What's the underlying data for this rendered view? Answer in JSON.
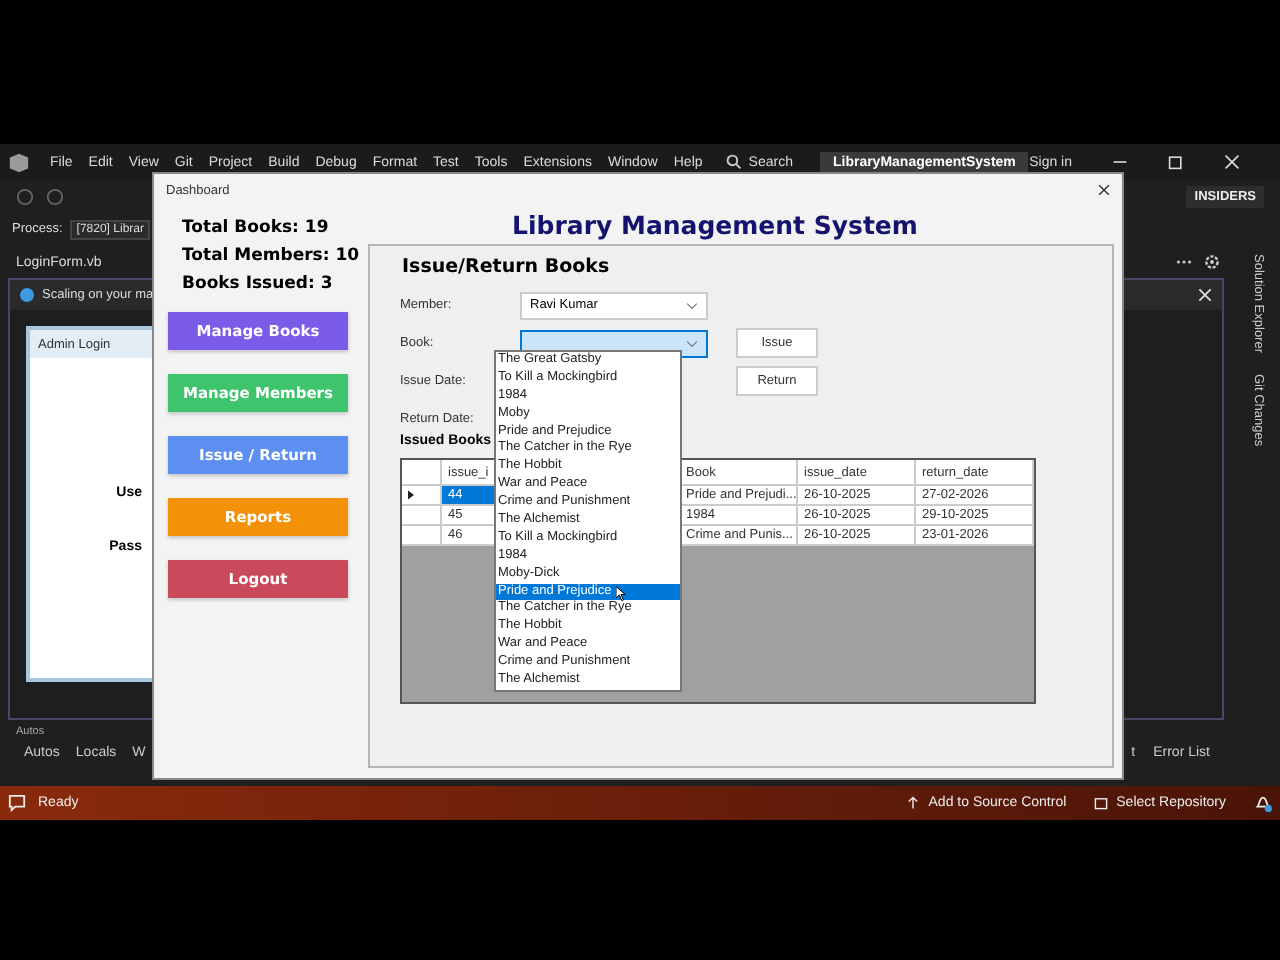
{
  "ide": {
    "menu": [
      "File",
      "Edit",
      "View",
      "Git",
      "Project",
      "Build",
      "Debug",
      "Format",
      "Test",
      "Tools",
      "Extensions",
      "Window",
      "Help"
    ],
    "search": "Search",
    "solution": "LibraryManagementSystem",
    "sign_in": "Sign in",
    "badge": "INSIDERS",
    "process_label": "Process:",
    "process_value": "[7820] Librar",
    "file_tab": "LoginForm.vb",
    "info_bar": "Scaling on your ma",
    "side_tabs": [
      "Solution Explorer",
      "Git Changes"
    ],
    "login_form": {
      "title": "Admin Login",
      "labels": [
        "Use",
        "Pass"
      ]
    },
    "bottom_panel_title": "Autos",
    "bottom_tabs": [
      "Autos",
      "Locals",
      "W"
    ],
    "bottom_tabs_right": [
      "t",
      "Error List"
    ],
    "status": {
      "text": "Ready",
      "source_control": "Add to Source Control",
      "repository": "Select Repository"
    }
  },
  "dialog": {
    "title": "Dashboard",
    "stats": [
      "Total Books: 19",
      "Total Members: 10",
      "Books Issued: 3"
    ],
    "nav": [
      {
        "label": "Manage Books",
        "color": "#7b5ce8"
      },
      {
        "label": "Manage Members",
        "color": "#3fc46e"
      },
      {
        "label": "Issue / Return",
        "color": "#5d8ff0"
      },
      {
        "label": "Reports",
        "color": "#f39208"
      },
      {
        "label": "Logout",
        "color": "#c94b5b"
      }
    ],
    "heading": "Library Management System",
    "section": "Issue/Return Books",
    "member": {
      "label": "Member:",
      "value": "Ravi Kumar"
    },
    "book": {
      "label": "Book:",
      "expanded": true
    },
    "date_labels": [
      "Issue Date:",
      "Return Date:"
    ],
    "buttons": [
      "Issue",
      "Return"
    ],
    "grid_title": "Issued Books",
    "grid": {
      "columns": [
        "issue_i",
        "Book",
        "issue_date",
        "return_date"
      ],
      "rows": [
        {
          "cells": [
            "44",
            "Pride and Prejudi...",
            "26-10-2025",
            "27-02-2026"
          ],
          "selected": true
        },
        {
          "cells": [
            "45",
            "1984",
            "26-10-2025",
            "29-10-2025"
          ],
          "selected": false
        },
        {
          "cells": [
            "46",
            "Crime and Punis...",
            "26-10-2025",
            "23-01-2026"
          ],
          "selected": false
        }
      ]
    },
    "book_options": [
      {
        "label": "The Great Gatsby",
        "selected": false
      },
      {
        "label": "To Kill a Mockingbird",
        "selected": false
      },
      {
        "label": "1984",
        "selected": false
      },
      {
        "label": "Moby",
        "selected": false
      },
      {
        "label": "Pride and Prejudice",
        "selected": false
      },
      {
        "label": "The Catcher in the Rye",
        "selected": false
      },
      {
        "label": "The Hobbit",
        "selected": false
      },
      {
        "label": "War and Peace",
        "selected": false
      },
      {
        "label": "Crime and Punishment",
        "selected": false
      },
      {
        "label": "The Alchemist",
        "selected": false
      },
      {
        "label": "To Kill a Mockingbird",
        "selected": false
      },
      {
        "label": "1984",
        "selected": false
      },
      {
        "label": "Moby-Dick",
        "selected": false
      },
      {
        "label": "Pride and Prejudice",
        "selected": true
      },
      {
        "label": "The Catcher in the Rye",
        "selected": false
      },
      {
        "label": "The Hobbit",
        "selected": false
      },
      {
        "label": "War and Peace",
        "selected": false
      },
      {
        "label": "Crime and Punishment",
        "selected": false
      },
      {
        "label": "The Alchemist",
        "selected": false
      }
    ]
  }
}
